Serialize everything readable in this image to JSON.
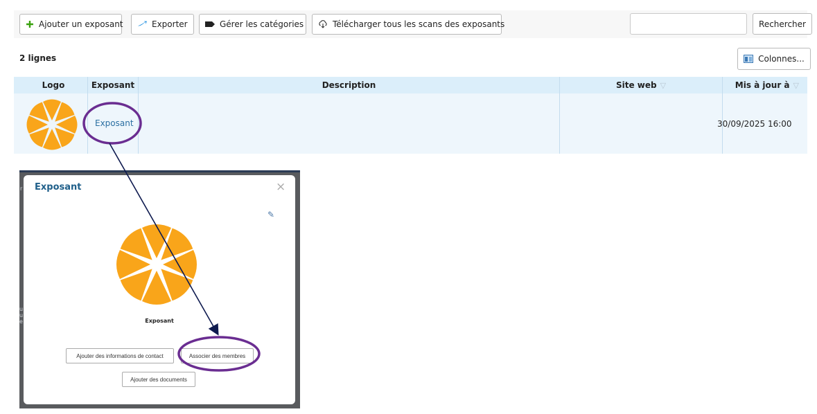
{
  "toolbar": {
    "add_exhibitor": "Ajouter un exposant",
    "export": "Exporter",
    "manage_categories": "Gérer les catégories",
    "download_scans": "Télécharger tous les scans des exposants",
    "search_value": "",
    "search_button": "Rechercher"
  },
  "list": {
    "row_count": "2 lignes",
    "columns_button": "Colonnes..."
  },
  "table": {
    "headers": {
      "logo": "Logo",
      "exposant": "Exposant",
      "description": "Description",
      "site_web": "Site web",
      "updated": "Mis à jour à"
    },
    "rows": [
      {
        "exposant": "Exposant",
        "description": "",
        "site_web": "",
        "updated": "30/09/2025 16:00"
      }
    ]
  },
  "modal": {
    "title": "Exposant",
    "close": "×",
    "edit_icon": "✎",
    "name": "Exposant",
    "btn_contact": "Ajouter des informations de contact",
    "btn_members": "Associer des membres",
    "btn_documents": "Ajouter des documents"
  },
  "colors": {
    "accent_link": "#2b6fa2",
    "header_bg": "#dbeefa",
    "annotation_purple": "#6a2d91",
    "arrow_navy": "#0e1a4f",
    "logo_orange": "#f9a51a"
  },
  "icons": {
    "add": "plus-icon",
    "export": "export-icon",
    "categories": "tag-icon",
    "download": "cloud-download-icon",
    "columns": "columns-icon",
    "filter": "filter-icon",
    "edit": "pencil-icon",
    "close": "close-icon"
  }
}
